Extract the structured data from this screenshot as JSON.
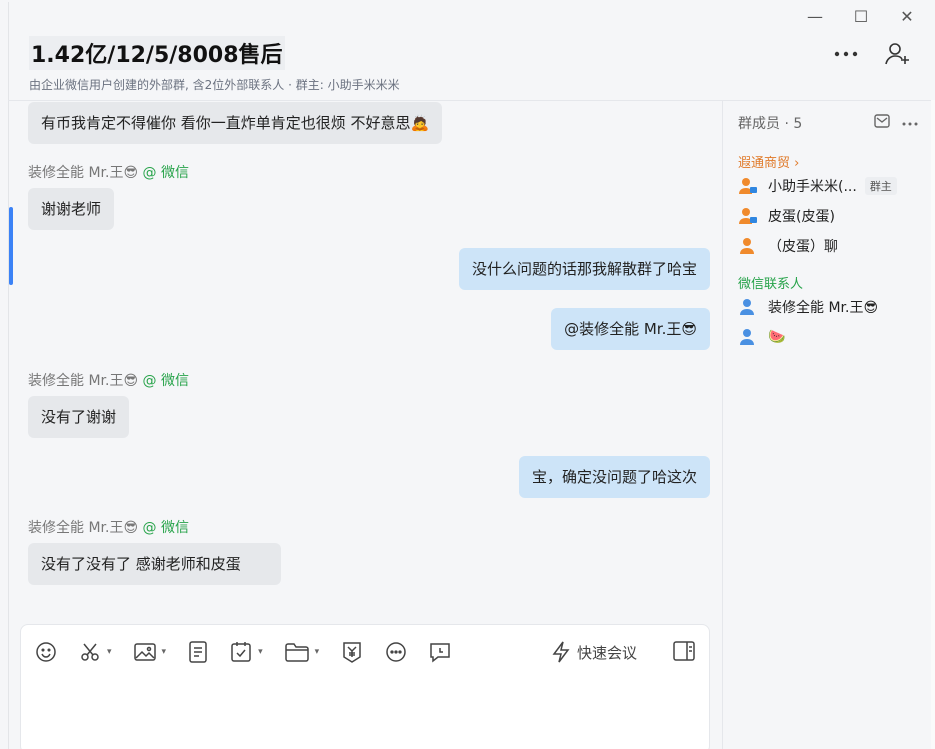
{
  "window": {
    "minimize": "—",
    "maximize": "☐",
    "close": "✕"
  },
  "header": {
    "title": "1.42亿/12/5/8008售后",
    "subtitle": "由企业微信用户创建的外部群, 含2位外部联系人 · 群主: 小助手米米米"
  },
  "messages": [
    {
      "dir": "in",
      "text": "有币我肯定不得催你 看你一直炸单肯定也很烦 不好意思🙇"
    },
    {
      "sender": "装修全能 Mr.王😎",
      "source": "@ 微信"
    },
    {
      "dir": "in",
      "text": "谢谢老师"
    },
    {
      "dir": "out",
      "text": "没什么问题的话那我解散群了哈宝"
    },
    {
      "dir": "out",
      "text": "@装修全能 Mr.王😎"
    },
    {
      "sender": "装修全能 Mr.王😎",
      "source": "@ 微信"
    },
    {
      "dir": "in",
      "text": "没有了谢谢"
    },
    {
      "dir": "out",
      "text": "宝，确定没问题了哈这次"
    },
    {
      "sender": "装修全能 Mr.王😎",
      "source": "@ 微信"
    },
    {
      "dir": "in",
      "text": "没有了没有了 感谢老师和皮蛋"
    }
  ],
  "sidebar": {
    "members_label": "群成员 · 5",
    "company_group": "遐通商贸 ›",
    "company_members": [
      {
        "name": "小助手米米(...",
        "badge": "群主"
      },
      {
        "name": "皮蛋(皮蛋)"
      },
      {
        "name": "（皮蛋）聊"
      }
    ],
    "wechat_group": "微信联系人",
    "wechat_members": [
      {
        "name": "装修全能 Mr.王😎"
      },
      {
        "name": "🍉"
      }
    ]
  },
  "composer": {
    "quick_meeting": "快速会议",
    "caret": "▾"
  },
  "colors": {
    "bubble_in": "#e6e8eb",
    "bubble_out": "#cde4f8",
    "source_green": "#27a34a",
    "group_orange": "#e07a2a",
    "accent_blue": "#3b82f6"
  }
}
